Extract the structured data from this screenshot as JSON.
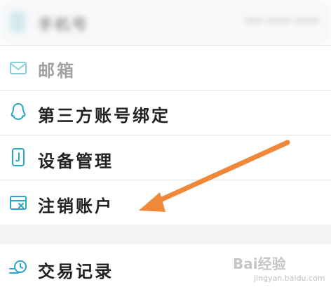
{
  "top_row": {
    "label": "手机号",
    "value": "*** **** ****",
    "icon": "phone-icon"
  },
  "menu": {
    "items": [
      {
        "label": "邮箱",
        "icon": "mail-icon"
      },
      {
        "label": "第三方账号绑定",
        "icon": "qq-penguin-icon"
      },
      {
        "label": "设备管理",
        "icon": "device-icon"
      },
      {
        "label": "注销账户",
        "icon": "account-close-icon"
      }
    ],
    "second_group": [
      {
        "label": "交易记录",
        "icon": "transaction-history-icon"
      }
    ]
  },
  "watermark": {
    "brand": "Bai经验",
    "domain": "jingyan.baidu.com"
  },
  "colors": {
    "icon": "#27a7c4",
    "arrow": "#f0883a",
    "divider": "#dcdfe3",
    "group_gap": "#f2f3f5"
  }
}
